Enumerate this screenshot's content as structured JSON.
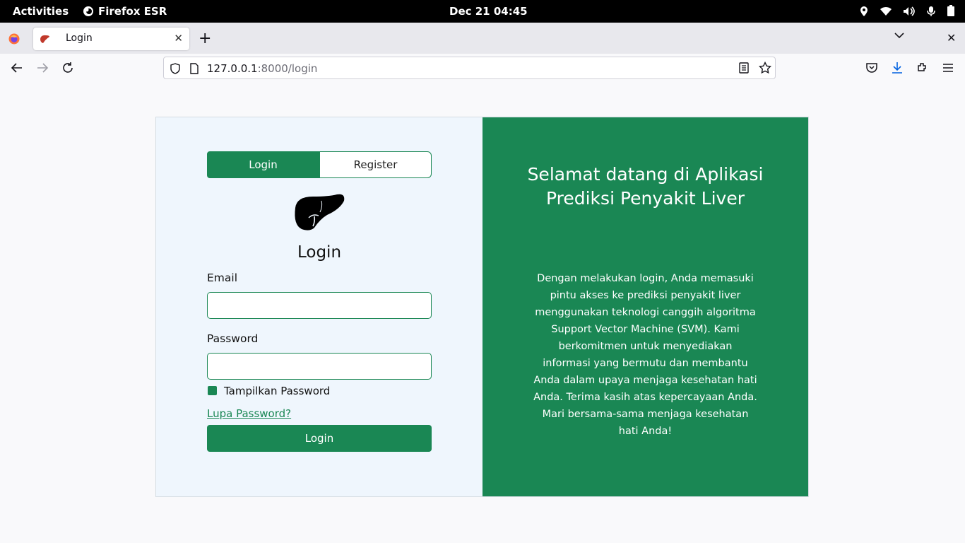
{
  "system_bar": {
    "activities": "Activities",
    "app_name": "Firefox ESR",
    "clock": "Dec 21  04:45",
    "tray_icons": [
      "location-icon",
      "wifi-icon",
      "volume-icon",
      "microphone-icon",
      "battery-icon"
    ]
  },
  "browser": {
    "tab_title": "Login",
    "url_host": "127.0.0.1",
    "url_rest": ":8000/login"
  },
  "page": {
    "tabs": {
      "login": "Login",
      "register": "Register"
    },
    "form_title": "Login",
    "email_label": "Email",
    "email_value": "",
    "password_label": "Password",
    "password_value": "",
    "show_password_label": "Tampilkan Password",
    "forgot_password": "Lupa Password?",
    "submit_label": "Login",
    "welcome_title": "Selamat datang di Aplikasi Prediksi Penyakit Liver",
    "welcome_text": "Dengan melakukan login, Anda memasuki pintu akses ke prediksi penyakit liver menggunakan teknologi canggih algoritma Support Vector Machine (SVM). Kami berkomitmen untuk menyediakan informasi yang bermutu dan membantu Anda dalam upaya menjaga kesehatan hati Anda. Terima kasih atas kepercayaan Anda. Mari bersama-sama menjaga kesehatan hati Anda!"
  },
  "colors": {
    "accent": "#1a8754",
    "left_panel": "#eff6fd"
  }
}
